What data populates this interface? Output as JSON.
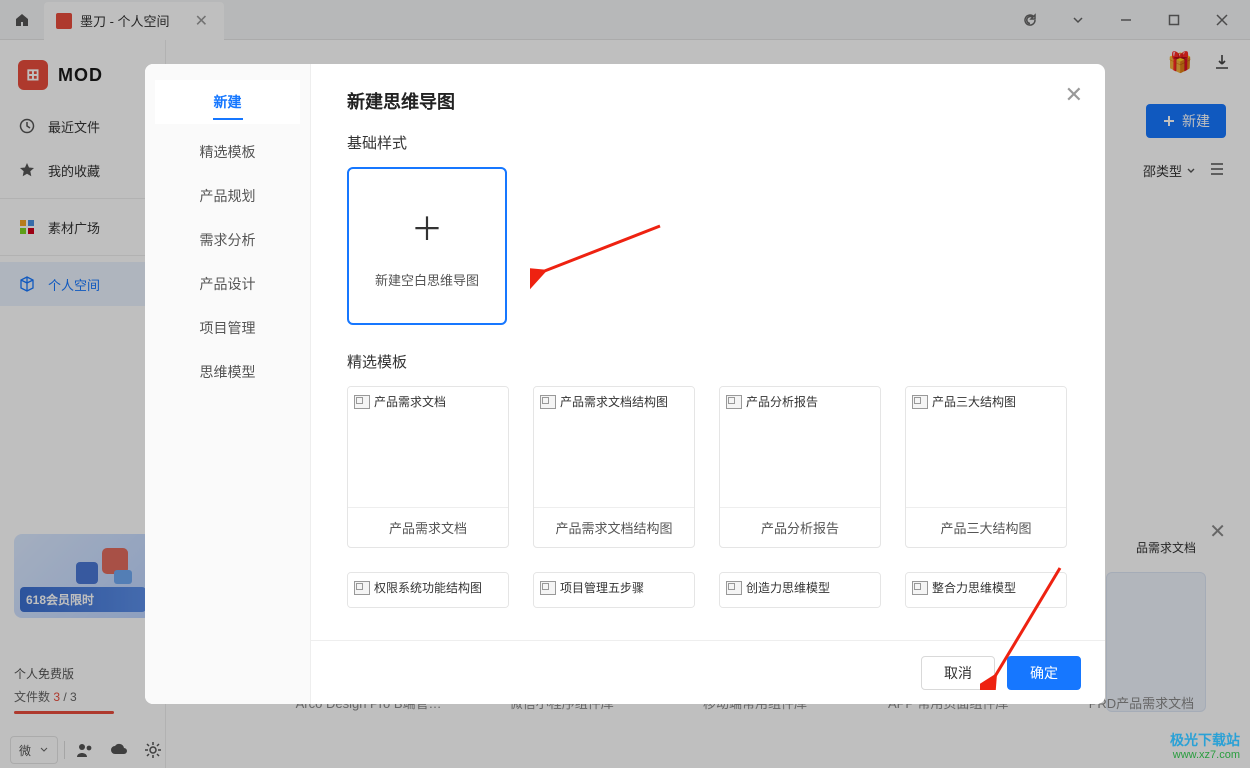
{
  "titlebar": {
    "tab_title": "墨刀 - 个人空间"
  },
  "sidebar": {
    "logo_text": "MOD",
    "items": [
      {
        "label": "最近文件",
        "icon": "clock"
      },
      {
        "label": "我的收藏",
        "icon": "star"
      },
      {
        "label": "素材广场",
        "icon": "grid"
      },
      {
        "label": "个人空间",
        "icon": "cube"
      }
    ],
    "promo_text": "618会员限时",
    "plan_name": "个人免费版",
    "file_count_label": "文件数",
    "file_count_used": "3",
    "file_count_total": "/ 3"
  },
  "bottom": {
    "wechat": "微"
  },
  "header": {
    "new_button": "新建",
    "filter_type": "邵类型",
    "list_icon": "list"
  },
  "bg_captions": [
    "Arco Design Pro B端管…",
    "微信小程序组件库",
    "移动端常用组件库",
    "APP 常用页面组件库",
    "PRD产品需求文档"
  ],
  "reco": {
    "title": "品需求文档"
  },
  "modal": {
    "title": "新建思维导图",
    "close": "✕",
    "tabs": [
      "新建",
      "精选模板",
      "产品规划",
      "需求分析",
      "产品设计",
      "项目管理",
      "思维模型"
    ],
    "section_basic": "基础样式",
    "blank_label": "新建空白思维导图",
    "section_featured": "精选模板",
    "templates_row1": [
      {
        "alt": "产品需求文档",
        "name": "产品需求文档"
      },
      {
        "alt": "产品需求文档结构图",
        "name": "产品需求文档结构图"
      },
      {
        "alt": "产品分析报告",
        "name": "产品分析报告"
      },
      {
        "alt": "产品三大结构图",
        "name": "产品三大结构图"
      }
    ],
    "templates_row2": [
      {
        "alt": "权限系统功能结构图"
      },
      {
        "alt": "项目管理五步骤"
      },
      {
        "alt": "创造力思维模型"
      },
      {
        "alt": "整合力思维模型"
      }
    ],
    "cancel": "取消",
    "confirm": "确定"
  },
  "watermark": {
    "brand": "极光下载站",
    "url": "www.xz7.com"
  }
}
